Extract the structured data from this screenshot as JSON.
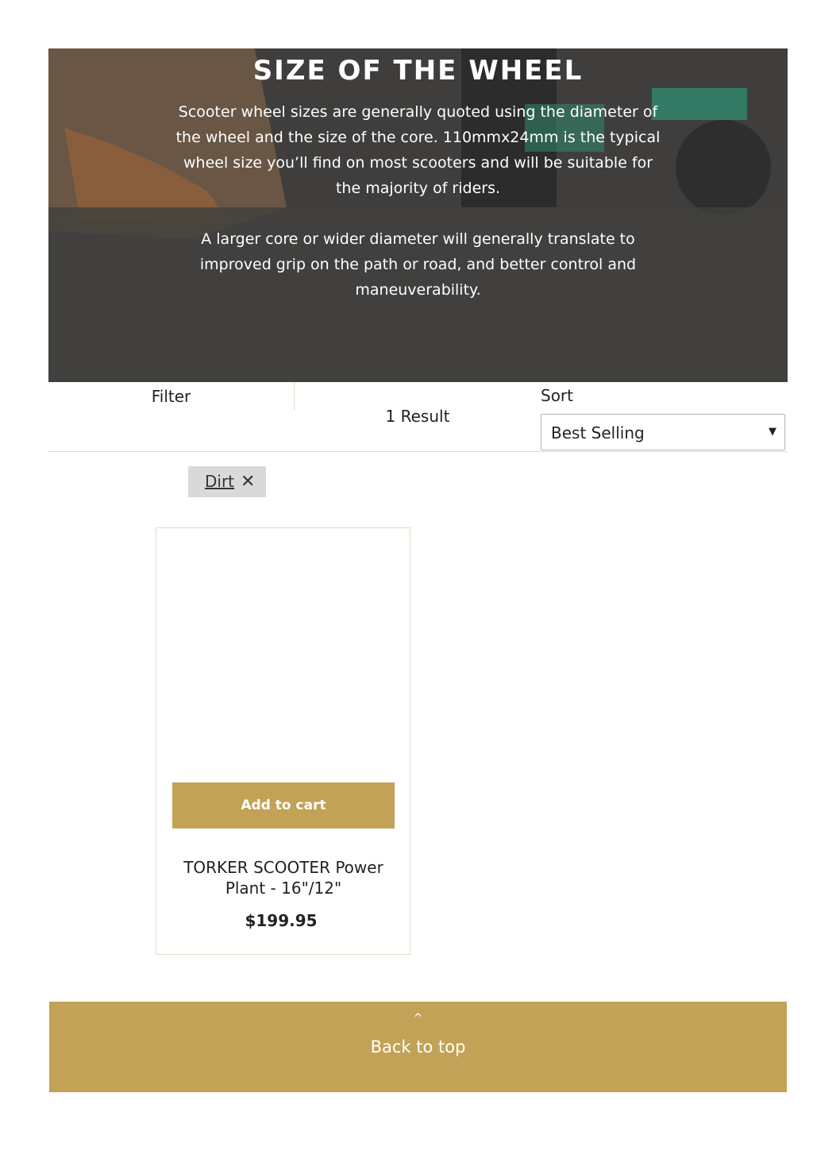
{
  "hero": {
    "title": "SIZE OF THE WHEEL",
    "paragraph_1": "Scooter wheel sizes are generally quoted using the diameter of the wheel and the size of the core. 110mmx24mm is the typical wheel size you’ll find on most scooters and will be suitable for the majority of riders.",
    "paragraph_2": "A larger core or wider diameter will generally translate to improved grip on the path or road, and better control and maneuverability."
  },
  "toolbar": {
    "filter_label": "Filter",
    "result_count": "1 Result",
    "sort_label": "Sort",
    "sort_value": "Best Selling",
    "sort_arrow": "▼"
  },
  "active_filter": {
    "label": "Dirt",
    "remove_glyph": "✕"
  },
  "products": [
    {
      "add_to_cart_label": "Add to cart",
      "title": "TORKER SCOOTER Power Plant - 16\"/12\"",
      "price": "$199.95"
    }
  ],
  "back_to_top": {
    "chevron": "^",
    "label": "Back to top"
  },
  "colors": {
    "accent_gold": "#c2a257",
    "divider": "#e6d9c3",
    "chip_bg": "#d9d9d9"
  }
}
